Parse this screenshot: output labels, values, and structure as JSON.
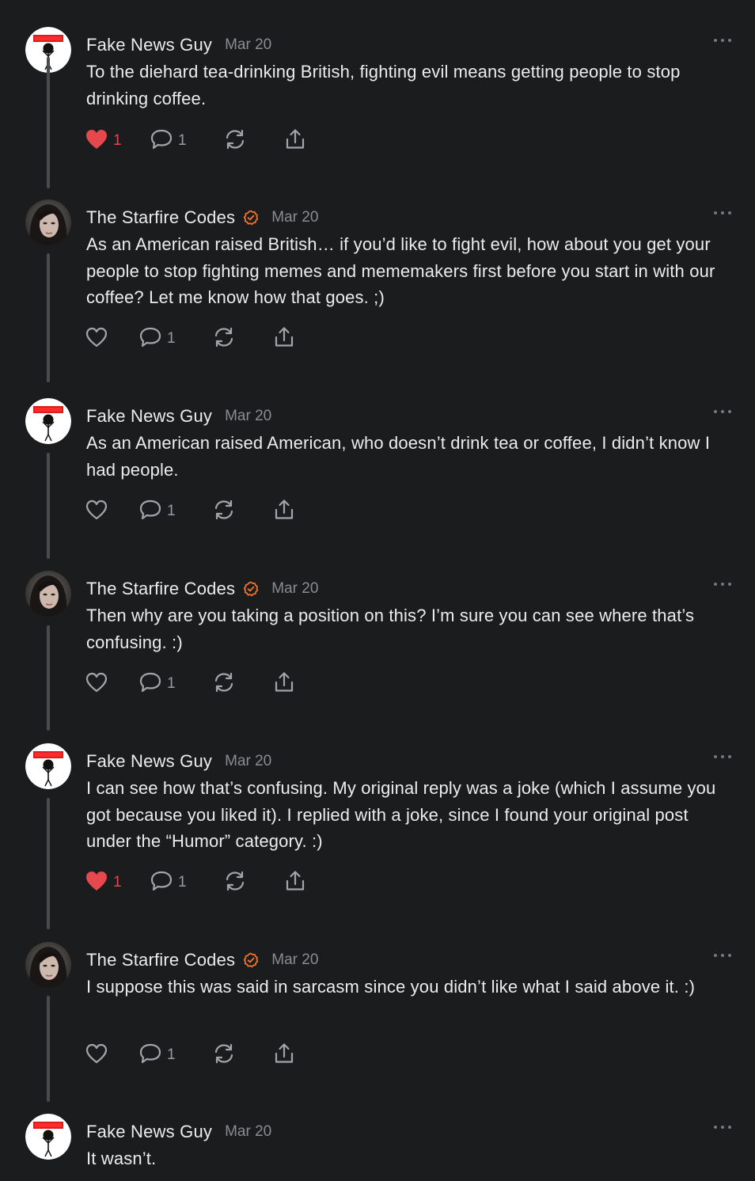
{
  "comments": [
    {
      "author": "Fake News Guy",
      "date": "Mar 20",
      "verified": false,
      "avatar_type": "fake-news-guy",
      "avatar_banner": "Fake News!",
      "text": "To the diehard tea-drinking British, fighting evil means getting people to stop drinking coffee.",
      "liked": true,
      "like_count": "1",
      "comment_count": "1"
    },
    {
      "author": "The Starfire Codes",
      "date": "Mar 20",
      "verified": true,
      "avatar_type": "photo",
      "text": "As an American raised British… if you’d like to fight evil, how about you get your people to stop fighting memes and mememakers first before you start in with our coffee? Let me know how that goes. ;)",
      "liked": false,
      "like_count": "",
      "comment_count": "1"
    },
    {
      "author": "Fake News Guy",
      "date": "Mar 20",
      "verified": false,
      "avatar_type": "fake-news-guy",
      "avatar_banner": "Fake News!",
      "text": "As an American raised American, who doesn’t drink tea or coffee, I didn’t know I had people.",
      "liked": false,
      "like_count": "",
      "comment_count": "1"
    },
    {
      "author": "The Starfire Codes",
      "date": "Mar 20",
      "verified": true,
      "avatar_type": "photo",
      "text": "Then why are you taking a position on this? I’m sure you can see where that’s confusing. :)",
      "liked": false,
      "like_count": "",
      "comment_count": "1"
    },
    {
      "author": "Fake News Guy",
      "date": "Mar 20",
      "verified": false,
      "avatar_type": "fake-news-guy",
      "avatar_banner": "Fake News!",
      "text": "I can see how that’s confusing. My original reply was a joke (which I assume you got because you liked it). I replied with a joke, since I found your original post under the “Humor” category. :)",
      "liked": true,
      "like_count": "1",
      "comment_count": "1"
    },
    {
      "author": "The Starfire Codes",
      "date": "Mar 20",
      "verified": true,
      "avatar_type": "photo",
      "text": "I suppose this was said in sarcasm since you didn’t like what I said above it. :)",
      "liked": false,
      "like_count": "",
      "comment_count": "1"
    },
    {
      "author": "Fake News Guy",
      "date": "Mar 20",
      "verified": false,
      "avatar_type": "fake-news-guy",
      "avatar_banner": "Fake News!",
      "text": "It wasn’t.",
      "liked": false,
      "like_count": "",
      "comment_count": ""
    }
  ],
  "icons": {
    "like": "heart-icon",
    "comment": "speech-bubble-icon",
    "restack": "restack-icon",
    "share": "share-icon",
    "more": "more-dots-icon",
    "verified": "verified-check-icon"
  },
  "colors": {
    "background": "#1b1c1e",
    "text": "#ececed",
    "muted": "#8b8c90",
    "liked": "#e5484d",
    "verified": "#f0742b",
    "thread_line": "#4a4b4e"
  }
}
